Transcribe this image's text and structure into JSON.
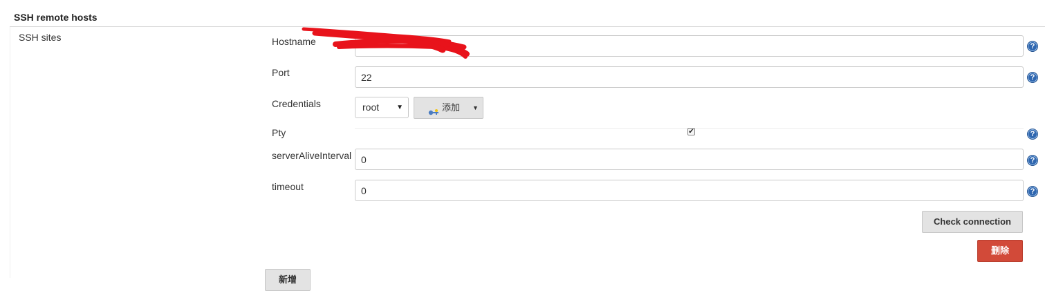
{
  "page": {
    "top_cut_text": "",
    "section_title": "SSH remote hosts",
    "group_label": "SSH sites"
  },
  "form": {
    "hostname": {
      "label": "Hostname",
      "value": ""
    },
    "port": {
      "label": "Port",
      "value": "22"
    },
    "credentials": {
      "label": "Credentials",
      "selected": "root",
      "add_button_label": "添加"
    },
    "pty": {
      "label": "Pty",
      "checked": true
    },
    "server_alive_interval": {
      "label": "serverAliveInterval",
      "value": "0"
    },
    "timeout": {
      "label": "timeout",
      "value": "0"
    },
    "help_glyph": "?"
  },
  "buttons": {
    "check_connection": "Check connection",
    "delete": "删除",
    "add": "新增"
  },
  "colors": {
    "accent_help": "#2f67b0",
    "delete_button": "#d24a39",
    "redaction": "#e8131b"
  },
  "icons": [
    "help-icon",
    "key-icon",
    "chevron-down-icon",
    "checkmark-icon"
  ]
}
